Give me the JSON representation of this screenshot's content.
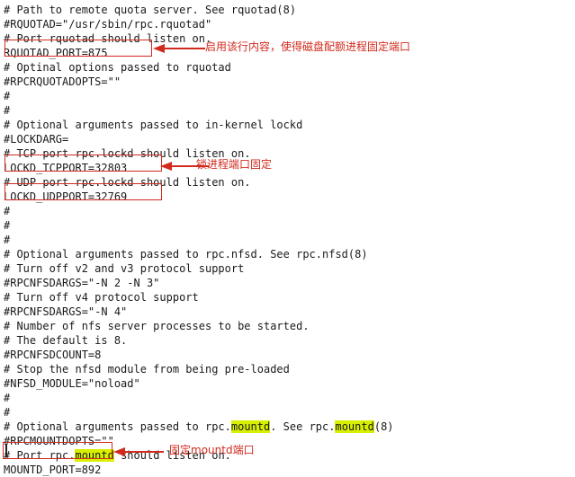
{
  "document": {
    "lines": [
      "# Path to remote quota server. See rquotad(8)",
      "#RQUOTAD=\"/usr/sbin/rpc.rquotad\"",
      "# Port rquotad should listen on.",
      "RQUOTAD_PORT=875",
      "# Optinal options passed to rquotad",
      "#RPCRQUOTADOPTS=\"\"",
      "#",
      "#",
      "# Optional arguments passed to in-kernel lockd",
      "#LOCKDARG=",
      "# TCP port rpc.lockd should listen on.",
      "LOCKD_TCPPORT=32803",
      "# UDP port rpc.lockd should listen on.",
      "LOCKD_UDPPORT=32769",
      "#",
      "#",
      "#",
      "# Optional arguments passed to rpc.nfsd. See rpc.nfsd(8)",
      "# Turn off v2 and v3 protocol support",
      "#RPCNFSDARGS=\"-N 2 -N 3\"",
      "# Turn off v4 protocol support",
      "#RPCNFSDARGS=\"-N 4\"",
      "# Number of nfs server processes to be started.",
      "# The default is 8.",
      "#RPCNFSDCOUNT=8",
      "# Stop the nfsd module from being pre-loaded",
      "#NFSD_MODULE=\"noload\"",
      "#",
      "#",
      "# Optional arguments passed to rpc.mountd. See rpc.mountd(8)",
      "#RPCMOUNTDOPTS=\"\"",
      "# Port rpc.mountd should listen on.",
      "MOUNTD_PORT=892"
    ],
    "highlight_word": "mountd",
    "highlight_color": "#d8f000"
  },
  "annotations": [
    {
      "name": "rquotad-port-note",
      "text": "启用该行内容，使得磁盘配额进程固定端口"
    },
    {
      "name": "lockd-port-note",
      "text": "锁进程端口固定"
    },
    {
      "name": "mountd-port-note",
      "text": "固定mountd端口"
    }
  ],
  "colors": {
    "annotation": "#d22b1e",
    "text": "#1a1a1a",
    "background": "#ffffff"
  }
}
